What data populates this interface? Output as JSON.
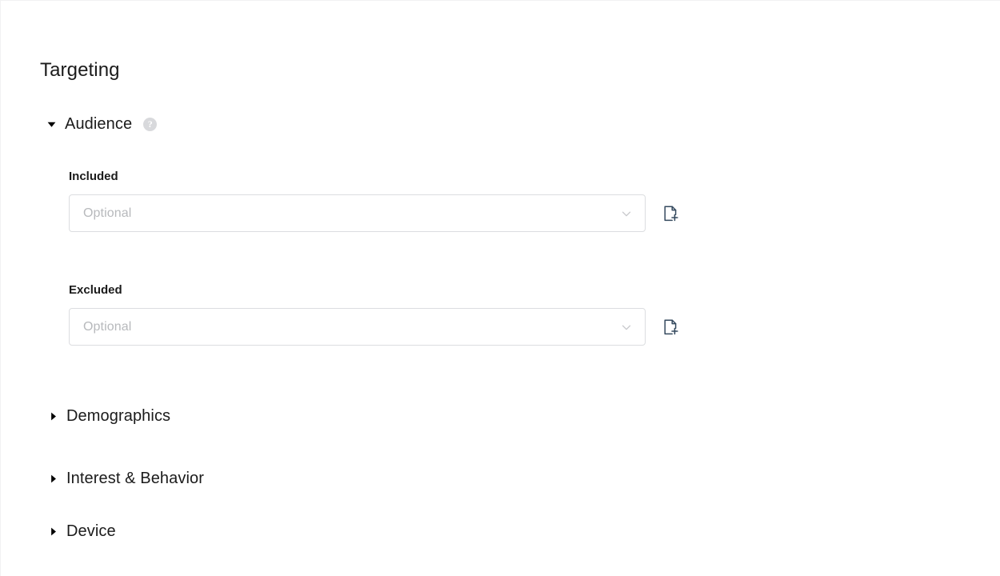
{
  "page": {
    "title": "Targeting",
    "background_color": "#ffffff"
  },
  "sections": [
    {
      "id": "audience",
      "label": "Audience",
      "expanded": true,
      "caret_icon": "caret-down-icon",
      "help_icon": "help-circle-icon",
      "help_glyph": "?"
    },
    {
      "id": "demographics",
      "label": "Demographics",
      "expanded": false,
      "caret_icon": "caret-right-icon"
    },
    {
      "id": "interest",
      "label": "Interest & Behavior",
      "expanded": false,
      "caret_icon": "caret-right-icon"
    },
    {
      "id": "device",
      "label": "Device",
      "expanded": false,
      "caret_icon": "caret-right-icon"
    }
  ],
  "fields": [
    {
      "id": "included",
      "label": "Included",
      "value": "",
      "placeholder": "Optional",
      "dropdown_icon": "chevron-down-icon",
      "upload_icon": "document-add-icon"
    },
    {
      "id": "excluded",
      "label": "Excluded",
      "value": "",
      "placeholder": "Optional",
      "dropdown_icon": "chevron-down-icon",
      "upload_icon": "document-add-icon"
    }
  ],
  "colors": {
    "text_primary": "#1b1b1b",
    "placeholder": "#b7b9bc",
    "border": "#dcdde0",
    "icon_accent": "#34495e",
    "help_badge_bg": "#d8d9dc",
    "chevron": "#c8c9cc"
  }
}
